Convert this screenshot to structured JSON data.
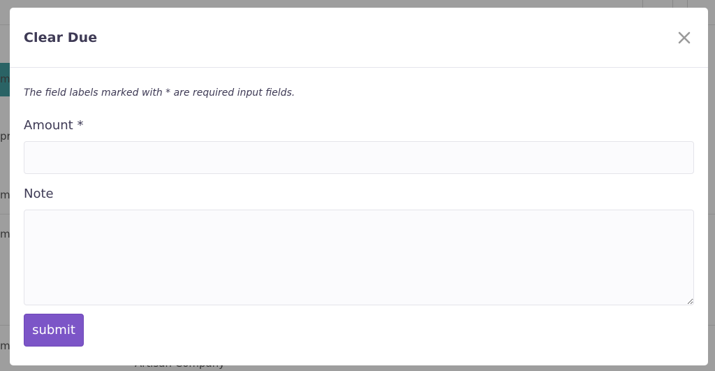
{
  "modal": {
    "title": "Clear Due",
    "close_icon": "close-icon",
    "required_note": "The field labels marked with * are required input fields.",
    "amount_label": "Amount *",
    "amount_value": "",
    "note_label": "Note",
    "note_value": "",
    "submit_label": "submit"
  },
  "background": {
    "partial_texts": [
      "me",
      "pro",
      "me",
      "me",
      "me",
      "Artisan Company"
    ]
  },
  "colors": {
    "accent": "#7c55c7",
    "title_text": "#3e3a55",
    "input_bg": "#fbfbfd",
    "background_teal": "#44a1a4"
  }
}
